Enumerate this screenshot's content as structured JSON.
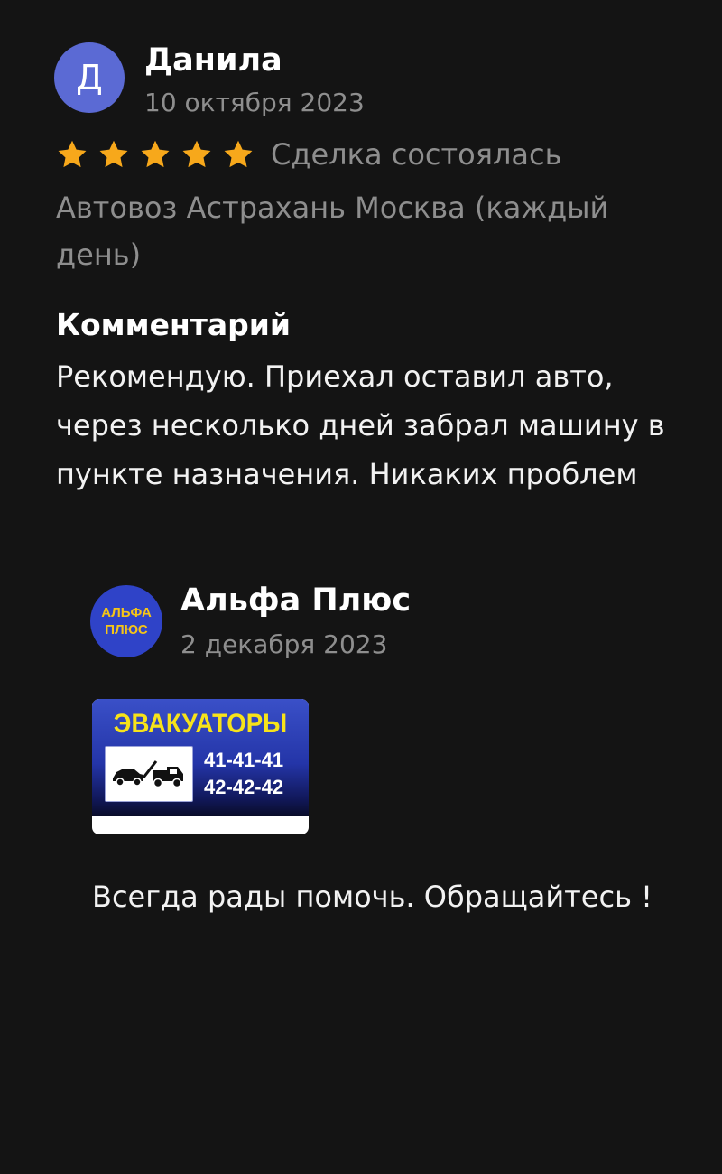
{
  "review": {
    "avatar_letter": "Д",
    "author_name": "Данила",
    "date": "10 октября 2023",
    "rating": 5,
    "rating_max": 5,
    "star_color": "#f7a81b",
    "deal_status": "Сделка состоялась",
    "listing_title": "Автовоз Астрахань Москва (каждый день)",
    "comment_heading": "Комментарий",
    "comment_text": "Рекомендую. Приехал оставил авто, через несколько дней забрал машину в пункте назначения. Никаких проблем"
  },
  "reply": {
    "avatar_line1": "АЛЬФА",
    "avatar_line2": "ПЛЮС",
    "seller_name": "Альфа Плюс",
    "date": "2 декабря 2023",
    "image": {
      "title": "ЭВАКУАТОРЫ",
      "phone_1": "41-41-41",
      "phone_2": "42-42-42",
      "icon": "tow-truck-icon"
    },
    "text": "Всегда рады помочь. Обращайтесь !"
  },
  "colors": {
    "background": "#141414",
    "avatar_bg": "#5b6ad4",
    "muted_text": "#8e8e8e",
    "brand_blue": "#2f43c8",
    "brand_yellow": "#f5c518"
  }
}
